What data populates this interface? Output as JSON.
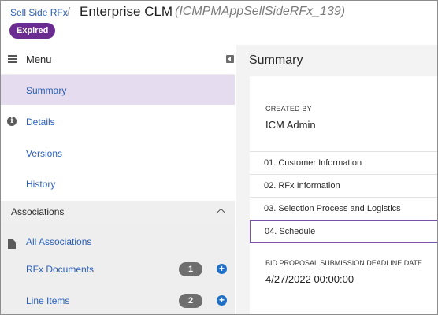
{
  "header": {
    "breadcrumb_link": "Sell Side RFx",
    "separator": "/",
    "title": "Enterprise CLM",
    "subtitle": "(ICMPMAppSellSideRFx_139)",
    "status": "Expired"
  },
  "sidebar": {
    "menu_label": "Menu",
    "items": [
      {
        "label": "Summary",
        "icon": "none",
        "active": true
      },
      {
        "label": "Details",
        "icon": "info-icon",
        "active": false
      },
      {
        "label": "Versions",
        "icon": "none",
        "active": false
      },
      {
        "label": "History",
        "icon": "none",
        "active": false
      }
    ],
    "associations": {
      "header": "Associations",
      "items": [
        {
          "label": "All Associations",
          "icon": "document-icon"
        },
        {
          "label": "RFx Documents",
          "count": "1"
        },
        {
          "label": "Line Items",
          "count": "2"
        }
      ]
    }
  },
  "main": {
    "title": "Summary",
    "created_by_caption": "CREATED BY",
    "created_by_value": "ICM Admin",
    "sections": [
      "01. Customer Information",
      "02. RFx Information",
      "03. Selection Process and Logistics",
      "04. Schedule"
    ],
    "deadline_caption": "BID PROPOSAL SUBMISSION DEADLINE DATE",
    "deadline_value": "4/27/2022 00:00:00"
  },
  "colors": {
    "accent": "#6b2c91",
    "link": "#2a5fb4",
    "active_nav": "#e5dcef",
    "add_button": "#1f6fc7"
  }
}
